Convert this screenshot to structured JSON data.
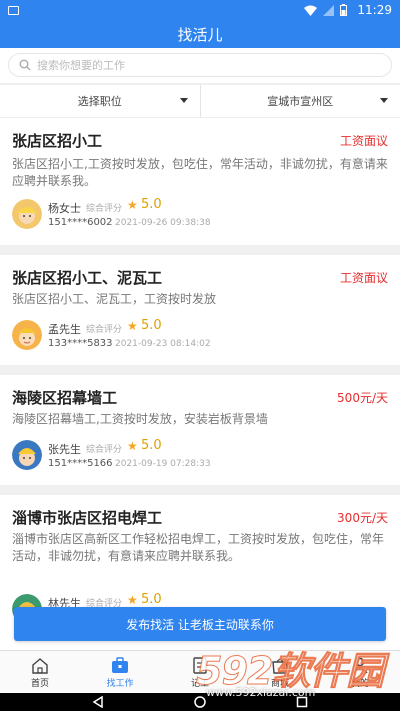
{
  "status_bar": {
    "time": "11:29"
  },
  "header": {
    "title": "找活儿"
  },
  "search": {
    "placeholder": "搜索你想要的工作"
  },
  "filters": {
    "position_label": "选择职位",
    "location_label": "宣城市宣州区"
  },
  "jobs": [
    {
      "title": "张店区招小工",
      "pay": "工资面议",
      "desc": "张店区招小工,工资按时发放，包吃住，常年活动，非诚勿扰，有意请来应聘并联系我。",
      "name": "杨女士",
      "rating_label": "综合评分",
      "score": "5.0",
      "phone": "151****6002",
      "time": "2021-09-26 09:38:38"
    },
    {
      "title": "张店区招小工、泥瓦工",
      "pay": "工资面议",
      "desc": "张店区招小工、泥瓦工，工资按时发放",
      "name": "孟先生",
      "rating_label": "综合评分",
      "score": "5.0",
      "phone": "133****5833",
      "time": "2021-09-23 08:14:02"
    },
    {
      "title": "海陵区招幕墙工",
      "pay": "500元/天",
      "desc": "海陵区招幕墙工,工资按时发放，安装岩板背景墙",
      "name": "张先生",
      "rating_label": "综合评分",
      "score": "5.0",
      "phone": "151****5166",
      "time": "2021-09-19 07:28:33"
    },
    {
      "title": "淄博市张店区招电焊工",
      "pay": "300元/天",
      "desc": "淄博市张店区高新区工作轻松招电焊工，工资按时发放，包吃住，常年活动，非诚勿扰，有意请来应聘并联系我。",
      "name": "林先生",
      "rating_label": "综合评分",
      "score": "5.0"
    }
  ],
  "cta": {
    "label": "发布找活 让老板主动联系你"
  },
  "tabs": [
    {
      "label": "首页",
      "icon": "home-icon"
    },
    {
      "label": "找工作",
      "icon": "briefcase-icon"
    },
    {
      "label": "记工",
      "icon": "note-icon"
    },
    {
      "label": "商城",
      "icon": "shop-icon"
    },
    {
      "label": "我的",
      "icon": "user-icon"
    }
  ],
  "watermark": {
    "brand": "592软件园",
    "url": "www.592xiazai.com"
  },
  "colors": {
    "primary": "#2f84ef",
    "pay": "#e52d2d",
    "star": "#f5a623"
  }
}
